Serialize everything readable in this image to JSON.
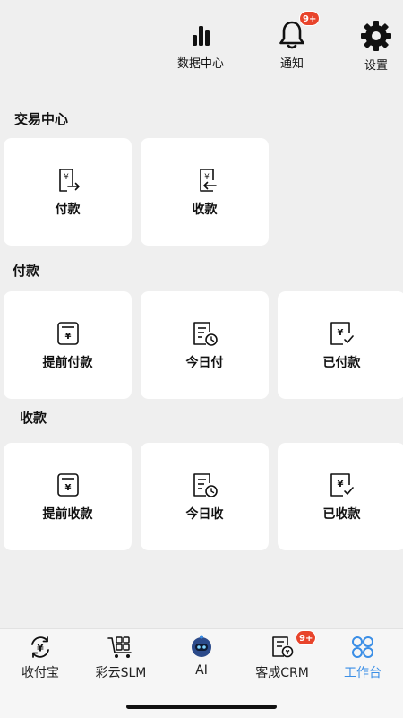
{
  "header": {
    "data_center_label": "数据中心",
    "notify_label": "通知",
    "notify_badge": "9+",
    "settings_label": "设置"
  },
  "sections": {
    "trade_title": "交易中心",
    "pay_title": "付款",
    "receive_title": "收款"
  },
  "trade_cards": {
    "pay": "付款",
    "receive": "收款"
  },
  "pay_cards": {
    "advance": "提前付款",
    "today": "今日付",
    "paid": "已付款"
  },
  "receive_cards": {
    "advance": "提前收款",
    "today": "今日收",
    "received": "已收款"
  },
  "tabs": {
    "shoufubao": "收付宝",
    "caiyun": "彩云SLM",
    "ai": "AI",
    "crm": "客成CRM",
    "crm_badge": "9+",
    "workbench": "工作台"
  },
  "colors": {
    "accent": "#3a8ee6",
    "badge": "#e8442b",
    "background": "#efefef"
  }
}
